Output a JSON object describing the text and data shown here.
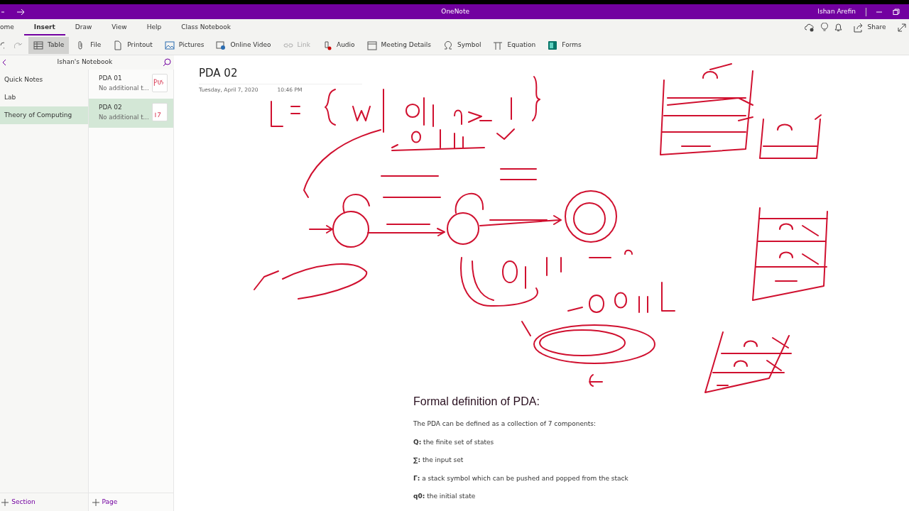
{
  "window": {
    "title": "OneNote",
    "user": "Ishan Arefin"
  },
  "ribbon_tabs": [
    {
      "label": "ome",
      "selected": false
    },
    {
      "label": "Insert",
      "selected": true
    },
    {
      "label": "Draw",
      "selected": false
    },
    {
      "label": "View",
      "selected": false
    },
    {
      "label": "Help",
      "selected": false
    },
    {
      "label": "Class Notebook",
      "selected": false
    }
  ],
  "ribbon_actions": {
    "share": "Share"
  },
  "toolbar": [
    {
      "kind": "table",
      "label": "Table",
      "highlighted": true,
      "disabled": false
    },
    {
      "kind": "file",
      "label": "File",
      "highlighted": false,
      "disabled": false
    },
    {
      "kind": "printout",
      "label": "Printout",
      "highlighted": false,
      "disabled": false
    },
    {
      "kind": "pictures",
      "label": "Pictures",
      "highlighted": false,
      "disabled": false
    },
    {
      "kind": "video",
      "label": "Online Video",
      "highlighted": false,
      "disabled": false
    },
    {
      "kind": "link",
      "label": "Link",
      "highlighted": false,
      "disabled": true
    },
    {
      "kind": "audio",
      "label": "Audio",
      "highlighted": false,
      "disabled": false
    },
    {
      "kind": "meeting",
      "label": "Meeting Details",
      "highlighted": false,
      "disabled": false
    },
    {
      "kind": "symbol",
      "label": "Symbol",
      "highlighted": false,
      "disabled": false
    },
    {
      "kind": "equation",
      "label": "Equation",
      "highlighted": false,
      "disabled": false
    },
    {
      "kind": "forms",
      "label": "Forms",
      "highlighted": false,
      "disabled": false
    }
  ],
  "notebook": {
    "name": "Ishan's Notebook",
    "sections": [
      {
        "label": "Quick Notes",
        "selected": false
      },
      {
        "label": "Lab",
        "selected": false
      },
      {
        "label": "Theory of Computing",
        "selected": true
      }
    ],
    "pages": [
      {
        "title": "PDA 01",
        "preview": "No additional t...",
        "selected": false
      },
      {
        "title": "PDA 02",
        "preview": "No additional t...",
        "selected": true
      }
    ],
    "add_section": "Section",
    "add_page": "Page"
  },
  "page": {
    "title": "PDA 02",
    "date": "Tuesday, April 7, 2020",
    "time": "10:46 PM",
    "heading": "Formal definition of PDA:",
    "paragraphs": [
      "The PDA can be defined as a collection of 7 components:",
      "**Q:** the finite set of states",
      "**∑:** the input set",
      "**Γ:** a stack symbol which can be pushed and popped from the stack",
      "**q0:** the initial state"
    ]
  }
}
